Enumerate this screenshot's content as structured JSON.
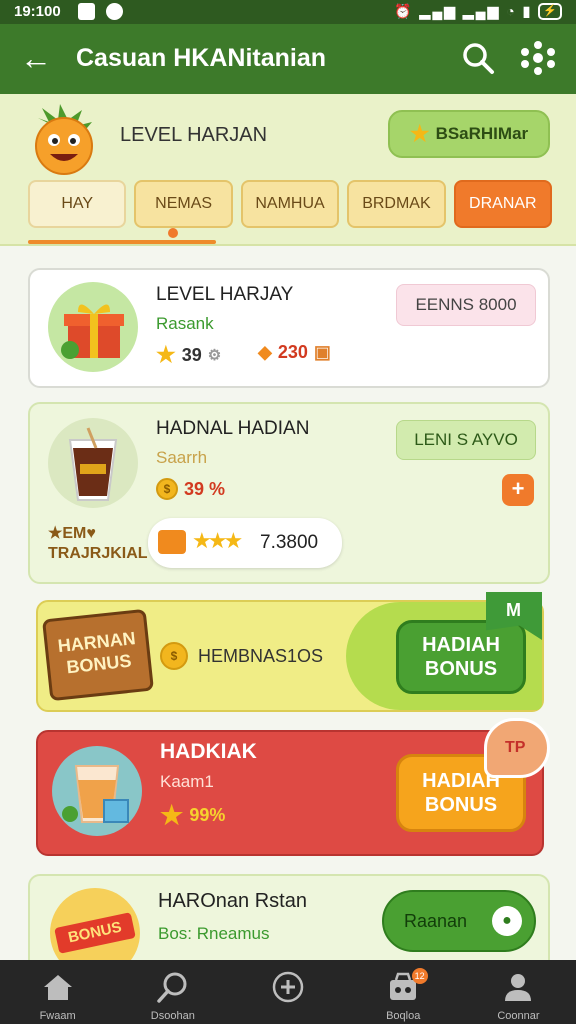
{
  "status_bar": {
    "time": "19:100"
  },
  "app_bar": {
    "title": "Casuan HKANitanian"
  },
  "level_header": {
    "title": "LEVEL HARJAN",
    "bonus_chip_label": "BSaRHIMar",
    "tabs": [
      "HAY",
      "NEMAS",
      "NAMHUA",
      "BRDMAK",
      "DRANAR"
    ],
    "active_tab_index": 4
  },
  "cards": [
    {
      "title": "LEVEL HARJAY",
      "subtitle": "Rasank",
      "stat1": "39",
      "stat2": "230",
      "pill": "EENNS 8000"
    },
    {
      "title": "HADNAL HADIAN",
      "subtitle": "Saarrh",
      "percent": "39 %",
      "pill": "LENI S AYVO",
      "tag": "★EM♥\nTRAJRJKIAL",
      "stat": "7.3800"
    },
    {
      "sign": "HARNAN\nBONUS",
      "label": "HEMBNAS1OS",
      "cta": "HADIAH\nBONUS",
      "corner": "M"
    },
    {
      "title": "HADKIAK",
      "subtitle": "Kaam1",
      "percent": "99%",
      "cta": "HADIAH\nBONUS",
      "corner": "TP"
    },
    {
      "title": "HAROnan Rstan",
      "subtitle": "Bos: Rneamus",
      "cta": "Raanan",
      "badge": "BONUS"
    }
  ],
  "bottom_nav": [
    {
      "label": "Fwaam",
      "icon": "home-icon"
    },
    {
      "label": "Dsoohan",
      "icon": "search-icon"
    },
    {
      "label": "",
      "icon": "add-icon"
    },
    {
      "label": "Boqloa",
      "icon": "cart-icon",
      "badge": "12"
    },
    {
      "label": "Coonnar",
      "icon": "profile-icon"
    }
  ],
  "colors": {
    "app_bar": "#3d7a2a",
    "accent_orange": "#f07a2b",
    "accent_green": "#4aa032",
    "danger_red": "#de4a44"
  }
}
